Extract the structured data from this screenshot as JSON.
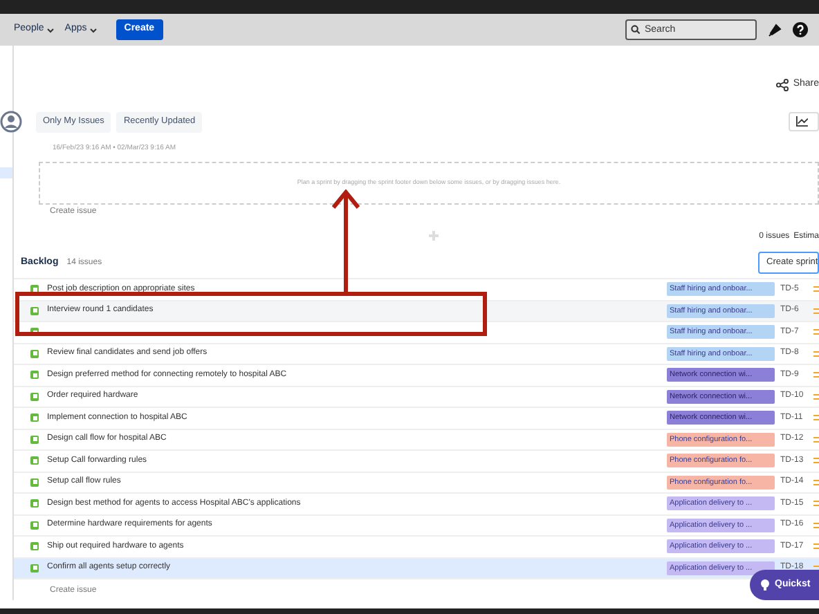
{
  "nav": {
    "menus": [
      "People",
      "Apps"
    ],
    "create": "Create",
    "search": {
      "placeholder": "Search"
    }
  },
  "share": "Share",
  "filters": [
    "Only My Issues",
    "Recently Updated"
  ],
  "sprint": {
    "dates": "16/Feb/23 9:16 AM • 02/Mar/23 9:16 AM",
    "hint": "Plan a sprint by dragging the sprint footer down below some issues, or by dragging issues here.",
    "create_issue": "Create issue",
    "count": "0 issues",
    "estimate": "Estima"
  },
  "backlog": {
    "title": "Backlog",
    "count": "14 issues",
    "create_sprint": "Create sprint",
    "create_issue": "Create issue",
    "rows": [
      {
        "summary": "Post job description on appropriate sites",
        "label": "Staff hiring and onboar...",
        "color": "#b3d4f5",
        "key": "TD-5",
        "selected": false
      },
      {
        "summary": "Interview round 1 candidates",
        "label": "Staff hiring and onboar...",
        "color": "#b3d4f5",
        "key": "TD-6",
        "selected": false
      },
      {
        "label": "Staff hiring and onboar...",
        "color": "#b3d4f5",
        "key": "TD-7",
        "selected": false
      },
      {
        "summary": "Review final candidates and send job offers",
        "label": "Staff hiring and onboar...",
        "color": "#b3d4f5",
        "key": "TD-8",
        "selected": false
      },
      {
        "summary": "Design preferred method for connecting remotely to hospital ABC",
        "label": "Network connection wi...",
        "color": "#8b7fd8",
        "key": "TD-9",
        "selected": false
      },
      {
        "summary": "Order required hardware",
        "label": "Network connection wi...",
        "color": "#8b7fd8",
        "key": "TD-10",
        "selected": false
      },
      {
        "summary": "Implement connection to hospital ABC",
        "label": "Network connection wi...",
        "color": "#8b7fd8",
        "key": "TD-11",
        "selected": false
      },
      {
        "summary": "Design call flow for hospital ABC",
        "label": "Phone configuration fo...",
        "color": "#f7b5a5",
        "key": "TD-12",
        "selected": false
      },
      {
        "summary": "Setup Call forwarding rules",
        "label": "Phone configuration fo...",
        "color": "#f7b5a5",
        "key": "TD-13",
        "selected": false
      },
      {
        "summary": "Setup call flow rules",
        "label": "Phone configuration fo...",
        "color": "#f7b5a5",
        "key": "TD-14",
        "selected": false
      },
      {
        "summary": "Design best method for agents to access Hospital ABC's applications",
        "label": "Application delivery to ...",
        "color": "#c4b9f3",
        "key": "TD-15",
        "selected": false
      },
      {
        "summary": "Determine hardware requirements for agents",
        "label": "Application delivery to ...",
        "color": "#c4b9f3",
        "key": "TD-16",
        "selected": false
      },
      {
        "summary": "Ship out required hardware to agents",
        "label": "Application delivery to ...",
        "color": "#c4b9f3",
        "key": "TD-17",
        "selected": false
      },
      {
        "summary": "Confirm all agents setup correctly",
        "label": "Application delivery to ...",
        "color": "#c4b9f3",
        "key": "TD-18",
        "selected": true
      }
    ]
  },
  "quickstart": "Quickst"
}
